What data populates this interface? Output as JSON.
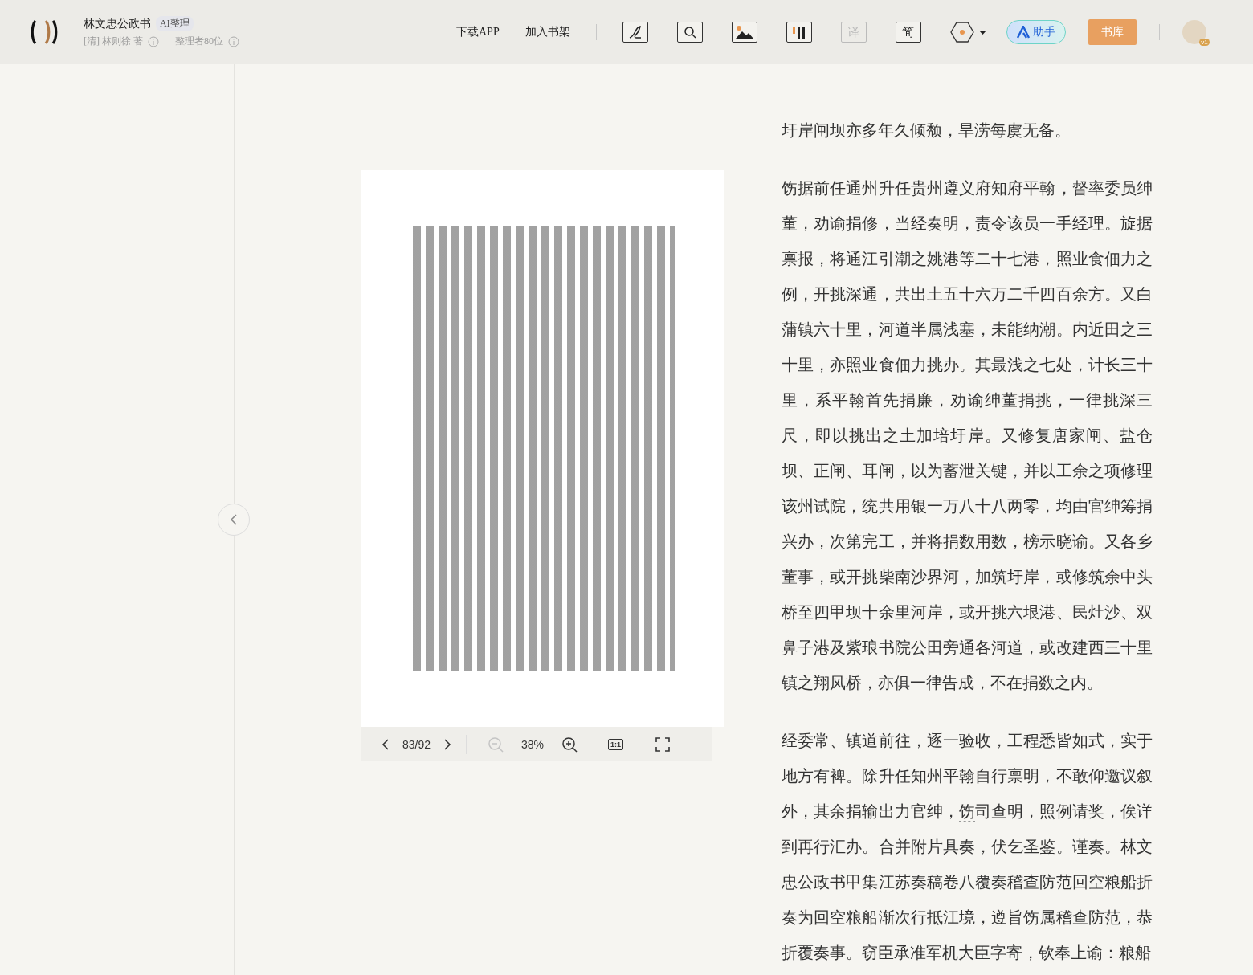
{
  "header": {
    "title": "林文忠公政书",
    "badge": "AI整理",
    "author": "[清] 林则徐 著",
    "contributors": "整理者80位",
    "links": [
      "下载APP",
      "加入书架"
    ],
    "tools": [
      {
        "kind": "pen",
        "disabled": false
      },
      {
        "kind": "search",
        "disabled": false
      },
      {
        "kind": "image",
        "disabled": false
      },
      {
        "kind": "columns",
        "disabled": false
      },
      {
        "kind": "text",
        "label": "译",
        "disabled": true
      },
      {
        "kind": "text",
        "label": "简",
        "disabled": false
      },
      {
        "kind": "theme",
        "disabled": false
      }
    ],
    "assistant": "助手",
    "library": "书库",
    "avatar_badge": "v1"
  },
  "viewer": {
    "page": "83/92",
    "zoom": "38%",
    "zoom_out_disabled": true,
    "actual_size": "1:1"
  },
  "paragraphs": [
    [
      {
        "text": "圩岸闸坝亦多年久倾颓，旱涝每虞无备。"
      }
    ],
    [
      {
        "text": "饬",
        "annotated": true
      },
      {
        "text": "据前任通州升任贵州遵义府知府平翰，督率委员绅董，劝谕捐修，当经奏明，责令该员一手经理。旋据禀报，将通江引潮之姚港等二十七港，照业食佃力之例，开挑深通，共出土五十六万二千四百余方。又白蒲镇六十里，河道半属浅塞，未能纳潮。内近田之三十里，亦照业食佃力挑办。其最浅之七处，计长三十里，系平翰首先捐廉，劝谕绅董捐挑，一律挑深三尺，即以挑出之土加培圩岸。又修复唐家闸、盐仓坝、正闸、耳闸，以为蓄泄关键，并以工余之项修理该州试院，统共用银一万八十八两零，均由官绅筹捐兴办，次第完工，并将捐数用数，榜示晓谕。又各乡董事，或开挑柴南沙界河，加筑圩岸，或修筑余中头桥至四甲坝十余里河岸，或开挑六垠港、民灶沙、双鼻子港及紫琅书院公田旁通各河道，或改建西三十里镇之翔凤桥，亦俱一律告成，不在捐数之内。"
      }
    ],
    [
      {
        "text": "经委常、镇道前往，逐一验收，工程悉皆如式，实于地方有裨。除升任知州平翰自行禀明，不敢仰邀议叙外，其余捐输出力官绅，"
      },
      {
        "text": "饬",
        "annotated": true
      },
      {
        "text": "司查明，照例请奖，俟详到再行汇办。合并附片具奏，伏乞圣鉴。谨奏。林文忠公政书甲集江苏奏稿卷八覆奏稽查防范回空粮船折奏为回空粮船渐次行抵江境，遵旨饬属稽查防范，恭折覆奏事。窃臣承准军机大臣字寄，钦奉上谕：粮船"
      }
    ]
  ]
}
